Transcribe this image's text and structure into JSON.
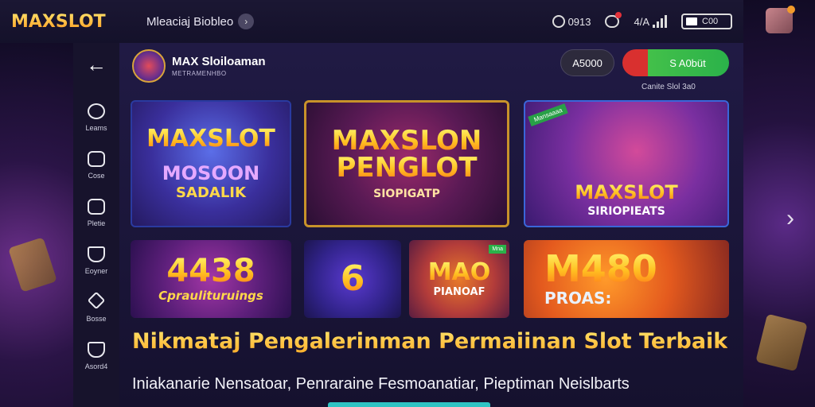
{
  "topbar": {
    "logo": "MAXSLOT",
    "title": "Mleaciaj Biobleo",
    "title_chevron": "›",
    "clock_text": "0913",
    "signal_text": "4/A",
    "battery_text": "C00"
  },
  "sidenav": {
    "back": "←",
    "items": [
      {
        "label": "Leams",
        "icon": "chat-icon"
      },
      {
        "label": "Cose",
        "icon": "pen-icon"
      },
      {
        "label": "Pletie",
        "icon": "screen-icon"
      },
      {
        "label": "Eoyner",
        "icon": "shield-icon"
      },
      {
        "label": "Bosse",
        "icon": "gift-icon"
      },
      {
        "label": "Asord4",
        "icon": "info-icon"
      }
    ]
  },
  "header": {
    "brand_name": "MAX Sloiloaman",
    "brand_sub": "METRAMENHBO",
    "secondary_btn": "A5000",
    "primary_btn": "S A0büt",
    "online_text": "Canite Slol 3a0"
  },
  "cards": {
    "c1": {
      "big": "MAXSLOT",
      "sub": "MOSOON",
      "sub2": "SADALIK"
    },
    "c2": {
      "big1": "MAXSLON",
      "big2": "PENGLOT",
      "sub": "SIOPIGATP"
    },
    "c3": {
      "ribbon": "Mansaaaa",
      "big": "MAXSLOT",
      "sub": "SIRIOPIEATS"
    },
    "c4": {
      "big": "4438",
      "sub": "Cpraulituruings"
    },
    "c5": {
      "big": "6"
    },
    "c6": {
      "big": "MAO",
      "sub": "PIANOAF",
      "ribbon": "Mna"
    },
    "c7": {
      "big": "M480",
      "sub": "PROAS:"
    }
  },
  "headline": "Nikmataj Pengalerinman Permaiinan Slot Terbaik",
  "subline": "Iniakanarie Nensatoar, Penraraine Fesmoanatiar, Pieptiman Neislbarts",
  "colors": {
    "accent_gold": "#ffc021",
    "primary_green": "#2bb24a",
    "primary_red": "#d9302f"
  }
}
